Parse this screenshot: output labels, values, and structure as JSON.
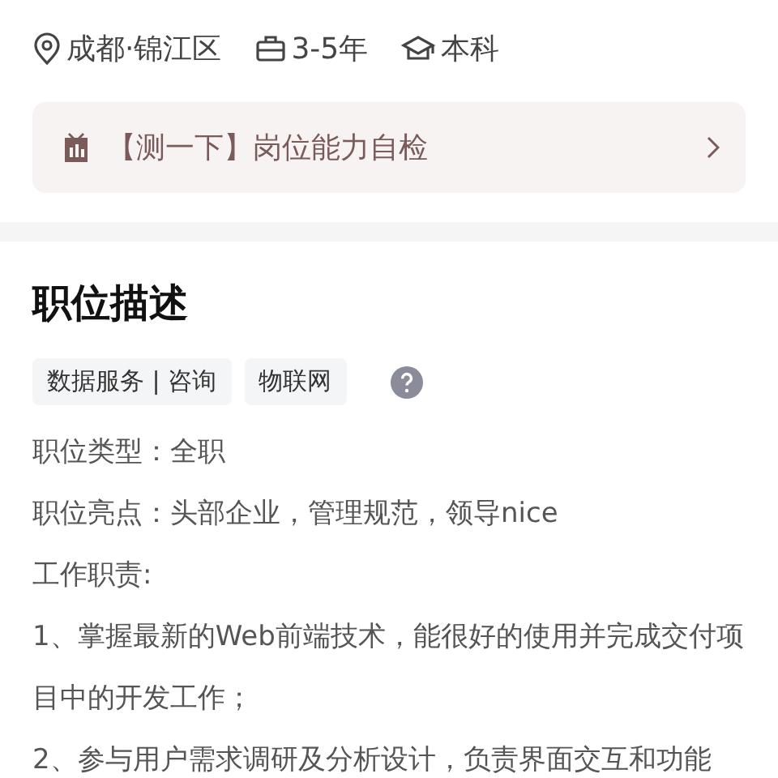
{
  "meta": [
    {
      "kind": "location",
      "text": "成都·锦江区"
    },
    {
      "kind": "experience",
      "text": "3-5年"
    },
    {
      "kind": "education",
      "text": "本科"
    }
  ],
  "self_check": {
    "text": "【测一下】岗位能力自检"
  },
  "description": {
    "title": "职位描述",
    "tags": [
      "数据服务 | 咨询",
      "物联网"
    ],
    "lines": [
      "职位类型：全职",
      "职位亮点：头部企业，管理规范，领导nice",
      "工作职责:",
      "1、掌握最新的Web前端技术，能很好的使用并完成交付项目中的开发工作；",
      "2、参与用户需求调研及分析设计，负责界面交互和功能"
    ]
  }
}
